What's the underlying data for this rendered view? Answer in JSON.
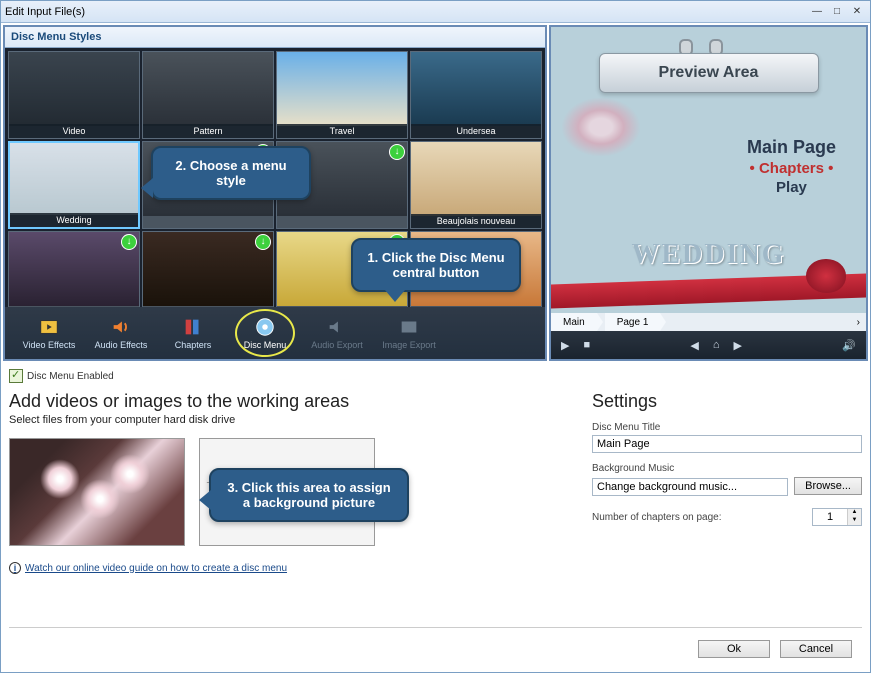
{
  "window": {
    "title": "Edit Input File(s)"
  },
  "styles": {
    "header": "Disc Menu Styles",
    "items": [
      {
        "label": "Video"
      },
      {
        "label": "Pattern"
      },
      {
        "label": "Travel"
      },
      {
        "label": "Undersea"
      },
      {
        "label": "Wedding"
      },
      {
        "label": ""
      },
      {
        "label": ""
      },
      {
        "label": "Beaujolais nouveau"
      },
      {
        "label": ""
      },
      {
        "label": ""
      },
      {
        "label": ""
      },
      {
        "label": ""
      }
    ]
  },
  "toolbar": {
    "items": [
      {
        "label": "Video Effects"
      },
      {
        "label": "Audio Effects"
      },
      {
        "label": "Chapters"
      },
      {
        "label": "Disc Menu"
      },
      {
        "label": "Audio Export"
      },
      {
        "label": "Image Export"
      }
    ]
  },
  "callouts": {
    "c1": "1. Click the Disc Menu central button",
    "c2": "2. Choose a menu style",
    "c3": "3. Click this area to assign a background picture"
  },
  "preview": {
    "label": "Preview Area",
    "menu_main": "Main Page",
    "menu_chapters": "• Chapters •",
    "menu_play": "Play",
    "decor_text": "WEDDING",
    "nav": {
      "main": "Main",
      "page": "Page 1"
    }
  },
  "disc_menu_enabled": "Disc Menu Enabled",
  "working": {
    "heading": "Add videos or images to the working areas",
    "sub": "Select files from your computer hard disk drive",
    "na_text": "The working area is not available for the current menu style"
  },
  "settings": {
    "heading": "Settings",
    "title_label": "Disc Menu Title",
    "title_value": "Main Page",
    "bg_label": "Background Music",
    "bg_value": "Change background music...",
    "browse": "Browse...",
    "chapters_label": "Number of chapters on page:",
    "chapters_value": "1"
  },
  "guide_link": "Watch our online video guide on how to create a disc menu",
  "buttons": {
    "ok": "Ok",
    "cancel": "Cancel"
  }
}
